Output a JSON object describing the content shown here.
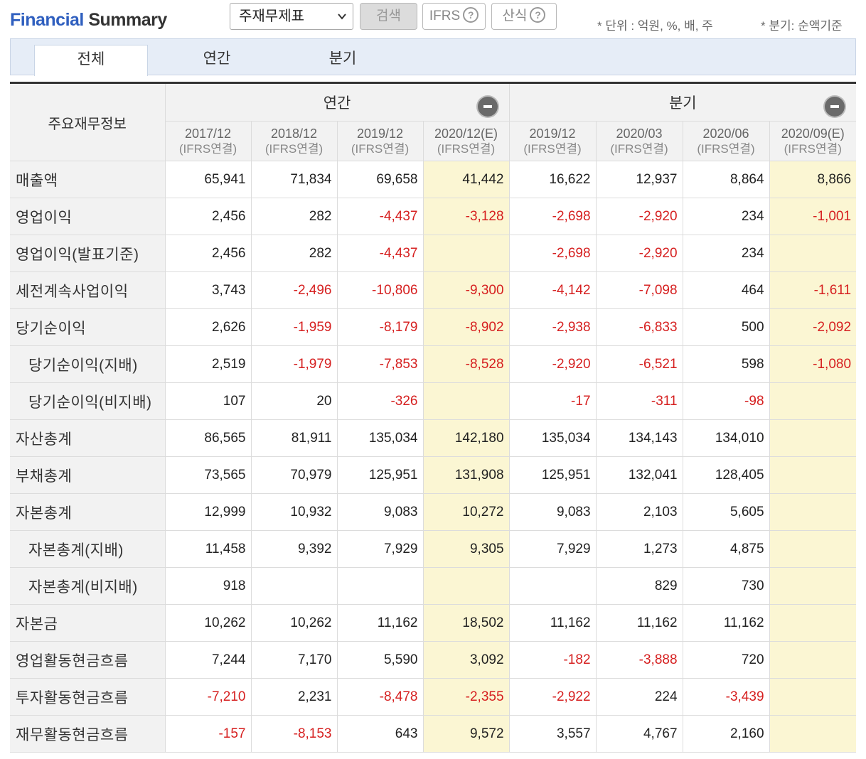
{
  "header": {
    "title_part1": "Financial",
    "title_part2": "Summary",
    "statement_select": "주재무제표",
    "search_button": "검색",
    "ifrs_button": "IFRS",
    "formula_button": "산식",
    "help_glyph": "?",
    "unit_note": "* 단위 : 억원, %, 배, 주",
    "basis_note": "* 분기: 순액기준"
  },
  "tabs": [
    {
      "label": "전체",
      "active": true
    },
    {
      "label": "연간",
      "active": false
    },
    {
      "label": "분기",
      "active": false
    }
  ],
  "table": {
    "corner_label": "주요재무정보",
    "groups": [
      {
        "label": "연간",
        "collapse_icon": "minus-circle-icon"
      },
      {
        "label": "분기",
        "collapse_icon": "minus-circle-icon"
      }
    ],
    "periods": [
      {
        "date": "2017/12",
        "basis": "(IFRS연결)",
        "estimate": false
      },
      {
        "date": "2018/12",
        "basis": "(IFRS연결)",
        "estimate": false
      },
      {
        "date": "2019/12",
        "basis": "(IFRS연결)",
        "estimate": false
      },
      {
        "date": "2020/12(E)",
        "basis": "(IFRS연결)",
        "estimate": true
      },
      {
        "date": "2019/12",
        "basis": "(IFRS연결)",
        "estimate": false
      },
      {
        "date": "2020/03",
        "basis": "(IFRS연결)",
        "estimate": false
      },
      {
        "date": "2020/06",
        "basis": "(IFRS연결)",
        "estimate": false
      },
      {
        "date": "2020/09(E)",
        "basis": "(IFRS연결)",
        "estimate": true
      }
    ],
    "rows": [
      {
        "label": "매출액",
        "sub": false,
        "values": [
          "65,941",
          "71,834",
          "69,658",
          "41,442",
          "16,622",
          "12,937",
          "8,864",
          "8,866"
        ]
      },
      {
        "label": "영업이익",
        "sub": false,
        "values": [
          "2,456",
          "282",
          "-4,437",
          "-3,128",
          "-2,698",
          "-2,920",
          "234",
          "-1,001"
        ]
      },
      {
        "label": "영업이익(발표기준)",
        "sub": false,
        "values": [
          "2,456",
          "282",
          "-4,437",
          "",
          "-2,698",
          "-2,920",
          "234",
          ""
        ]
      },
      {
        "label": "세전계속사업이익",
        "sub": false,
        "values": [
          "3,743",
          "-2,496",
          "-10,806",
          "-9,300",
          "-4,142",
          "-7,098",
          "464",
          "-1,611"
        ]
      },
      {
        "label": "당기순이익",
        "sub": false,
        "values": [
          "2,626",
          "-1,959",
          "-8,179",
          "-8,902",
          "-2,938",
          "-6,833",
          "500",
          "-2,092"
        ]
      },
      {
        "label": "당기순이익(지배)",
        "sub": true,
        "values": [
          "2,519",
          "-1,979",
          "-7,853",
          "-8,528",
          "-2,920",
          "-6,521",
          "598",
          "-1,080"
        ]
      },
      {
        "label": "당기순이익(비지배)",
        "sub": true,
        "values": [
          "107",
          "20",
          "-326",
          "",
          "-17",
          "-311",
          "-98",
          ""
        ]
      },
      {
        "label": "자산총계",
        "sub": false,
        "values": [
          "86,565",
          "81,911",
          "135,034",
          "142,180",
          "135,034",
          "134,143",
          "134,010",
          ""
        ]
      },
      {
        "label": "부채총계",
        "sub": false,
        "values": [
          "73,565",
          "70,979",
          "125,951",
          "131,908",
          "125,951",
          "132,041",
          "128,405",
          ""
        ]
      },
      {
        "label": "자본총계",
        "sub": false,
        "values": [
          "12,999",
          "10,932",
          "9,083",
          "10,272",
          "9,083",
          "2,103",
          "5,605",
          ""
        ]
      },
      {
        "label": "자본총계(지배)",
        "sub": true,
        "values": [
          "11,458",
          "9,392",
          "7,929",
          "9,305",
          "7,929",
          "1,273",
          "4,875",
          ""
        ]
      },
      {
        "label": "자본총계(비지배)",
        "sub": true,
        "values": [
          "918",
          "",
          "",
          "",
          "",
          "829",
          "730",
          ""
        ]
      },
      {
        "label": "자본금",
        "sub": false,
        "values": [
          "10,262",
          "10,262",
          "11,162",
          "18,502",
          "11,162",
          "11,162",
          "11,162",
          ""
        ]
      },
      {
        "label": "영업활동현금흐름",
        "sub": false,
        "values": [
          "7,244",
          "7,170",
          "5,590",
          "3,092",
          "-182",
          "-3,888",
          "720",
          ""
        ]
      },
      {
        "label": "투자활동현금흐름",
        "sub": false,
        "values": [
          "-7,210",
          "2,231",
          "-8,478",
          "-2,355",
          "-2,922",
          "224",
          "-3,439",
          ""
        ]
      },
      {
        "label": "재무활동현금흐름",
        "sub": false,
        "values": [
          "-157",
          "-8,153",
          "643",
          "9,572",
          "3,557",
          "4,767",
          "2,160",
          ""
        ]
      }
    ]
  },
  "colors": {
    "brand_blue": "#2f5fbf",
    "negative_red": "#d62020",
    "estimate_bg": "#fbf6d3",
    "tabbar_bg": "#e6edf7"
  }
}
